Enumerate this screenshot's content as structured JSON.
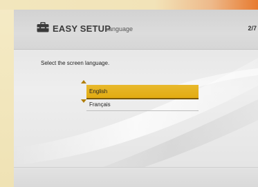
{
  "header": {
    "title": "EASY SETUP",
    "subtitle": "Language",
    "page_counter": "2/7",
    "icon": "toolbox-icon"
  },
  "main": {
    "instruction": "Select the screen language.",
    "languages": [
      {
        "label": "English",
        "selected": true
      },
      {
        "label": "Français",
        "selected": false
      }
    ]
  },
  "colors": {
    "selection_fill": "#e2ab11",
    "selection_border": "#7a5800",
    "scroll_arrow": "#b07e0a",
    "bezel_accent": "#e77a2f"
  }
}
